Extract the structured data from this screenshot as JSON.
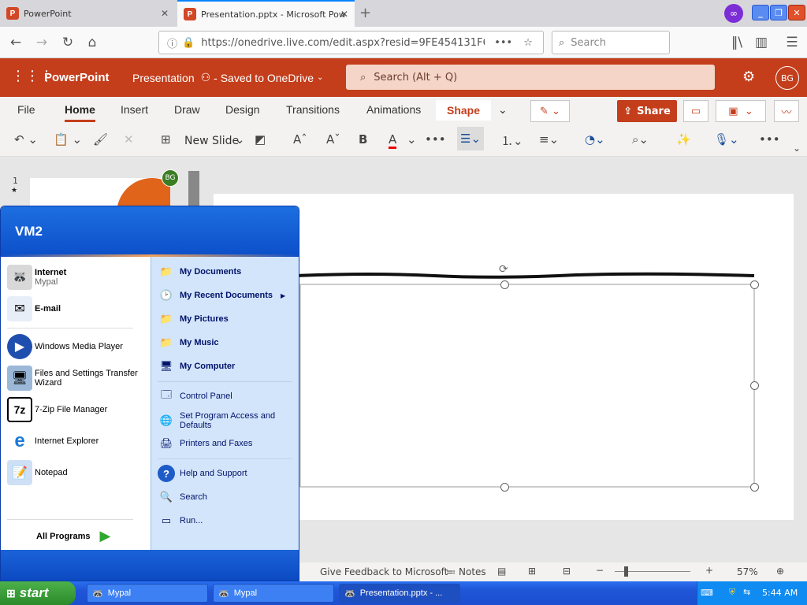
{
  "browser": {
    "tabs": [
      {
        "label": "PowerPoint",
        "icon": "P"
      },
      {
        "label": "Presentation.pptx - Microsoft Pow",
        "icon": "P"
      }
    ],
    "url": "https://onedrive.live.com/edit.aspx?resid=9FE454131F69BD5",
    "search_placeholder": "Search"
  },
  "office": {
    "app_name": "PowerPoint",
    "doc_title": "Presentation",
    "save_status": "- Saved to OneDrive",
    "search_placeholder": "Search (Alt + Q)",
    "avatar": "BG"
  },
  "ribbon": {
    "tabs": [
      "File",
      "Home",
      "Insert",
      "Draw",
      "Design",
      "Transitions",
      "Animations",
      "Shape"
    ],
    "selected_tab": "Home",
    "share_label": "Share",
    "new_slide_label": "New Slide"
  },
  "thumbnails": {
    "slide_number": "1",
    "presence_badge": "BG"
  },
  "statusbar": {
    "feedback": "Give Feedback to Microsoft",
    "notes": "Notes",
    "zoom": "57%"
  },
  "startmenu": {
    "user": "VM2",
    "pinned": [
      {
        "title": "Internet",
        "subtitle": "Mypal"
      },
      {
        "title": "E-mail",
        "subtitle": ""
      }
    ],
    "recent": [
      "Windows Media Player",
      "Files and Settings Transfer Wizard",
      "7-Zip File Manager",
      "Internet Explorer",
      "Notepad"
    ],
    "all_programs": "All Programs",
    "right_top": [
      "My Documents",
      "My Recent Documents",
      "My Pictures",
      "My Music",
      "My Computer"
    ],
    "right_mid": [
      "Control Panel",
      "Set Program Access and Defaults",
      "Printers and Faxes"
    ],
    "right_bottom": [
      "Help and Support",
      "Search",
      "Run..."
    ]
  },
  "taskbar": {
    "start_label": "start",
    "buttons": [
      "Mypal",
      "Mypal",
      "Presentation.pptx - ..."
    ],
    "clock": "5:44 AM"
  },
  "colors": {
    "office_accent": "#c43e1c",
    "xp_blue": "#1f55d6",
    "start_green": "#2b8a2a"
  }
}
